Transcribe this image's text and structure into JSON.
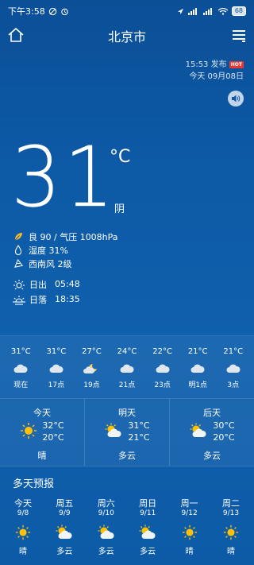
{
  "status_bar": {
    "time": "下午3:58",
    "battery": "68"
  },
  "header": {
    "city": "北京市"
  },
  "publish": {
    "time": "15:53 发布",
    "badge": "HOT",
    "date": "今天 09月08日"
  },
  "current": {
    "temperature": "31",
    "unit": "°C",
    "condition": "阴"
  },
  "details": {
    "aqi_pressure": "良 90 / 气压 1008hPa",
    "humidity": "湿度 31%",
    "wind": "西南风 2级"
  },
  "sun": {
    "sunrise_label": "日出",
    "sunrise_time": "05:48",
    "sunset_label": "日落",
    "sunset_time": "18:35"
  },
  "hourly": [
    {
      "temp": "31°C",
      "icon": "cloudy-icon",
      "time": "现在"
    },
    {
      "temp": "31°C",
      "icon": "cloudy-icon",
      "time": "17点"
    },
    {
      "temp": "27°C",
      "icon": "moon-cloud-icon",
      "time": "19点"
    },
    {
      "temp": "24°C",
      "icon": "cloudy-icon",
      "time": "21点"
    },
    {
      "temp": "22°C",
      "icon": "cloudy-icon",
      "time": "23点"
    },
    {
      "temp": "21°C",
      "icon": "cloudy-icon",
      "time": "明1点"
    },
    {
      "temp": "21°C",
      "icon": "cloudy-icon",
      "time": "3点"
    }
  ],
  "three_days": [
    {
      "name": "今天",
      "high": "32°C",
      "low": "20°C",
      "desc": "晴",
      "icon": "sunny-icon"
    },
    {
      "name": "明天",
      "high": "31°C",
      "low": "21°C",
      "desc": "多云",
      "icon": "partly-cloudy-icon"
    },
    {
      "name": "后天",
      "high": "30°C",
      "low": "20°C",
      "desc": "多云",
      "icon": "partly-cloudy-icon"
    }
  ],
  "multi_day": {
    "title": "多天预报",
    "days": [
      {
        "name": "今天",
        "date": "9/8",
        "desc": "晴",
        "icon": "sunny-icon"
      },
      {
        "name": "周五",
        "date": "9/9",
        "desc": "多云",
        "icon": "partly-cloudy-icon"
      },
      {
        "name": "周六",
        "date": "9/10",
        "desc": "多云",
        "icon": "partly-cloudy-icon"
      },
      {
        "name": "周日",
        "date": "9/11",
        "desc": "多云",
        "icon": "partly-cloudy-icon"
      },
      {
        "name": "周一",
        "date": "9/12",
        "desc": "晴",
        "icon": "sunny-icon"
      },
      {
        "name": "周二",
        "date": "9/13",
        "desc": "晴",
        "icon": "sunny-icon"
      }
    ]
  },
  "colors": {
    "background": "#0d5aa6",
    "sun": "#ffc107",
    "hot_badge": "#e53935"
  }
}
